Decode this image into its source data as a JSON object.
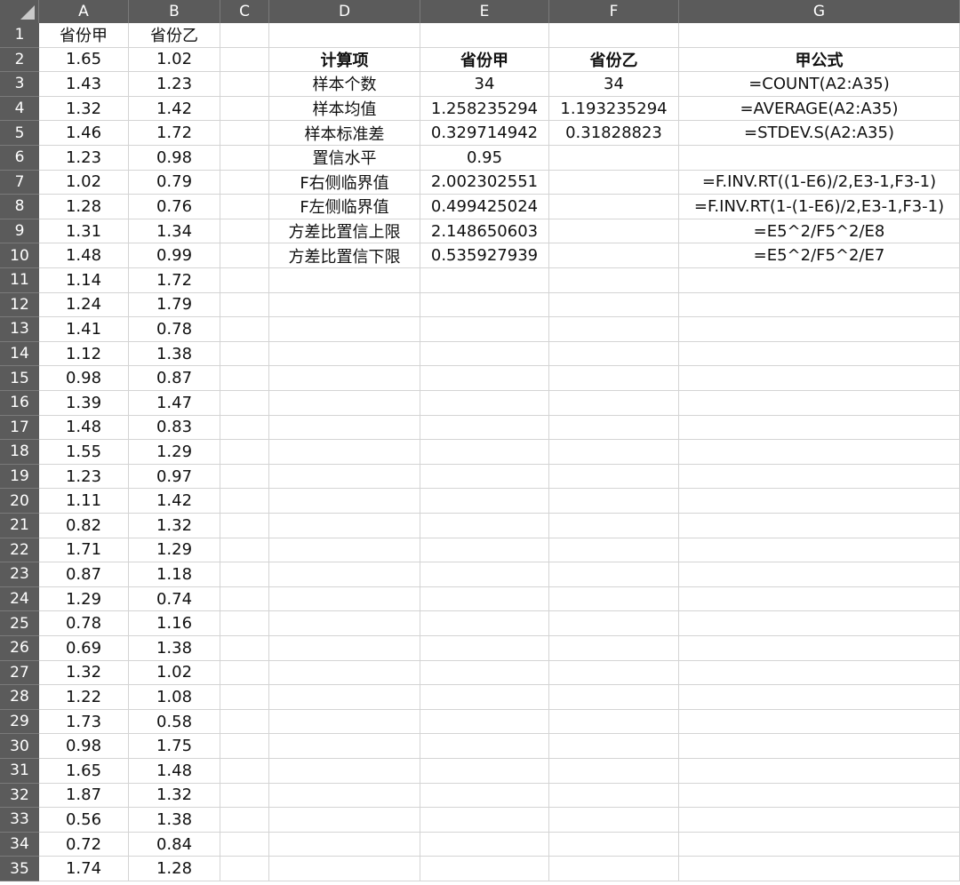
{
  "columns": [
    "A",
    "B",
    "C",
    "D",
    "E",
    "F",
    "G"
  ],
  "data_columns": {
    "A_header": "省份甲",
    "B_header": "省份乙",
    "A": [
      "1.65",
      "1.43",
      "1.32",
      "1.46",
      "1.23",
      "1.02",
      "1.28",
      "1.31",
      "1.48",
      "1.14",
      "1.24",
      "1.41",
      "1.12",
      "0.98",
      "1.39",
      "1.48",
      "1.55",
      "1.23",
      "1.11",
      "0.82",
      "1.71",
      "0.87",
      "1.29",
      "0.78",
      "0.69",
      "1.32",
      "1.22",
      "1.73",
      "0.98",
      "1.65",
      "1.87",
      "0.56",
      "0.72",
      "1.74"
    ],
    "B": [
      "1.02",
      "1.23",
      "1.42",
      "1.72",
      "0.98",
      "0.79",
      "0.76",
      "1.34",
      "0.99",
      "1.72",
      "1.79",
      "0.78",
      "1.38",
      "0.87",
      "1.47",
      "0.83",
      "1.29",
      "0.97",
      "1.42",
      "1.32",
      "1.29",
      "1.18",
      "0.74",
      "1.16",
      "1.38",
      "1.02",
      "1.08",
      "0.58",
      "1.75",
      "1.48",
      "1.32",
      "1.38",
      "0.84",
      "1.28"
    ]
  },
  "calc_table": {
    "header": [
      "计算项",
      "省份甲",
      "省份乙",
      "甲公式"
    ],
    "rows": [
      [
        "样本个数",
        "34",
        "34",
        "=COUNT(A2:A35)"
      ],
      [
        "样本均值",
        "1.258235294",
        "1.193235294",
        "=AVERAGE(A2:A35)"
      ],
      [
        "样本标准差",
        "0.329714942",
        "0.31828823",
        "=STDEV.S(A2:A35)"
      ],
      [
        "置信水平",
        "0.95",
        "",
        ""
      ],
      [
        "F右侧临界值",
        "2.002302551",
        "",
        "=F.INV.RT((1-E6)/2,E3-1,F3-1)"
      ],
      [
        "F左侧临界值",
        "0.499425024",
        "",
        "=F.INV.RT(1-(1-E6)/2,E3-1,F3-1)"
      ],
      [
        "方差比置信上限",
        "2.148650603",
        "",
        "=E5^2/F5^2/E8"
      ],
      [
        "方差比置信下限",
        "0.535927939",
        "",
        "=E5^2/F5^2/E7"
      ]
    ]
  },
  "row_count": 35,
  "colors": {
    "header_bg": "#5b5b5b",
    "header_text": "#ffffff",
    "grid": "#d4d4d4"
  }
}
